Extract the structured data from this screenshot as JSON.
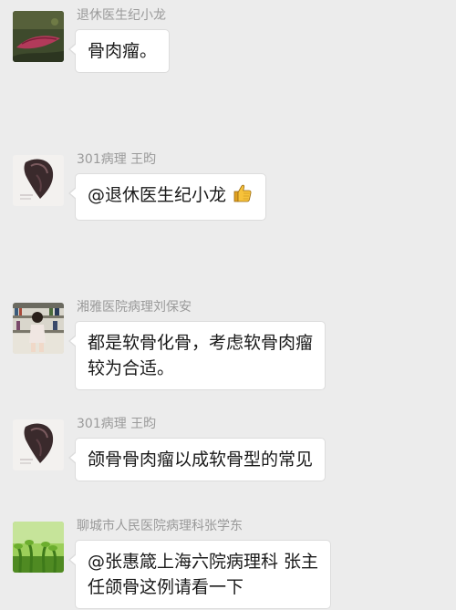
{
  "messages": [
    {
      "sender": "退休医生纪小龙",
      "avatar": "plant-leaf-avatar",
      "lines": [
        "骨肉瘤。"
      ]
    },
    {
      "sender": "301病理 王昀",
      "avatar": "sketch-portrait-avatar",
      "lines": [
        "@退休医生纪小龙"
      ],
      "emoji": "thumbs-up-icon"
    },
    {
      "sender": "湘雅医院病理刘保安",
      "avatar": "child-at-bookshelf-avatar",
      "lines": [
        "都是软骨化骨，考虑软骨肉瘤",
        "较为合适。"
      ]
    },
    {
      "sender": "301病理 王昀",
      "avatar": "sketch-portrait-avatar",
      "lines": [
        "颌骨骨肉瘤以成软骨型的常见"
      ]
    },
    {
      "sender": "聊城市人民医院病理科张学东",
      "avatar": "green-sprouts-avatar",
      "lines": [
        "@张惠箴上海六院病理科 张主",
        "任颌骨这例请看一下"
      ]
    }
  ],
  "colors": {
    "background": "#ececec",
    "bubble": "#ffffff",
    "sender_name": "#9a9a9a",
    "text": "#1a1a1a"
  }
}
